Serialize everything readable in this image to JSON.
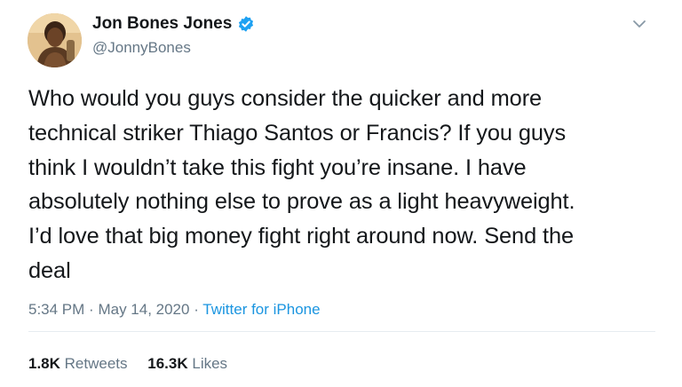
{
  "author": {
    "name": "Jon Bones Jones",
    "handle": "@JonnyBones"
  },
  "tweet": {
    "lines": [
      "Who would you guys consider the quicker and more",
      "technical striker Thiago Santos or Francis? If you guys",
      "think I wouldn’t take this fight you’re insane. I have",
      "absolutely nothing else to prove as a light heavyweight.",
      "I’d love that big money fight right around now. Send the",
      "deal"
    ],
    "time": "5:34 PM",
    "date": "May 14, 2020",
    "separator": "·",
    "source": "Twitter for iPhone"
  },
  "stats": {
    "retweets_count": "1.8K",
    "retweets_label": "Retweets",
    "likes_count": "16.3K",
    "likes_label": "Likes"
  },
  "colors": {
    "accent": "#1b95e0",
    "verified": "#1da1f2",
    "muted": "#657786",
    "text": "#14171a"
  },
  "icons": {
    "verified": "verified-badge-icon",
    "menu": "chevron-down-icon"
  }
}
